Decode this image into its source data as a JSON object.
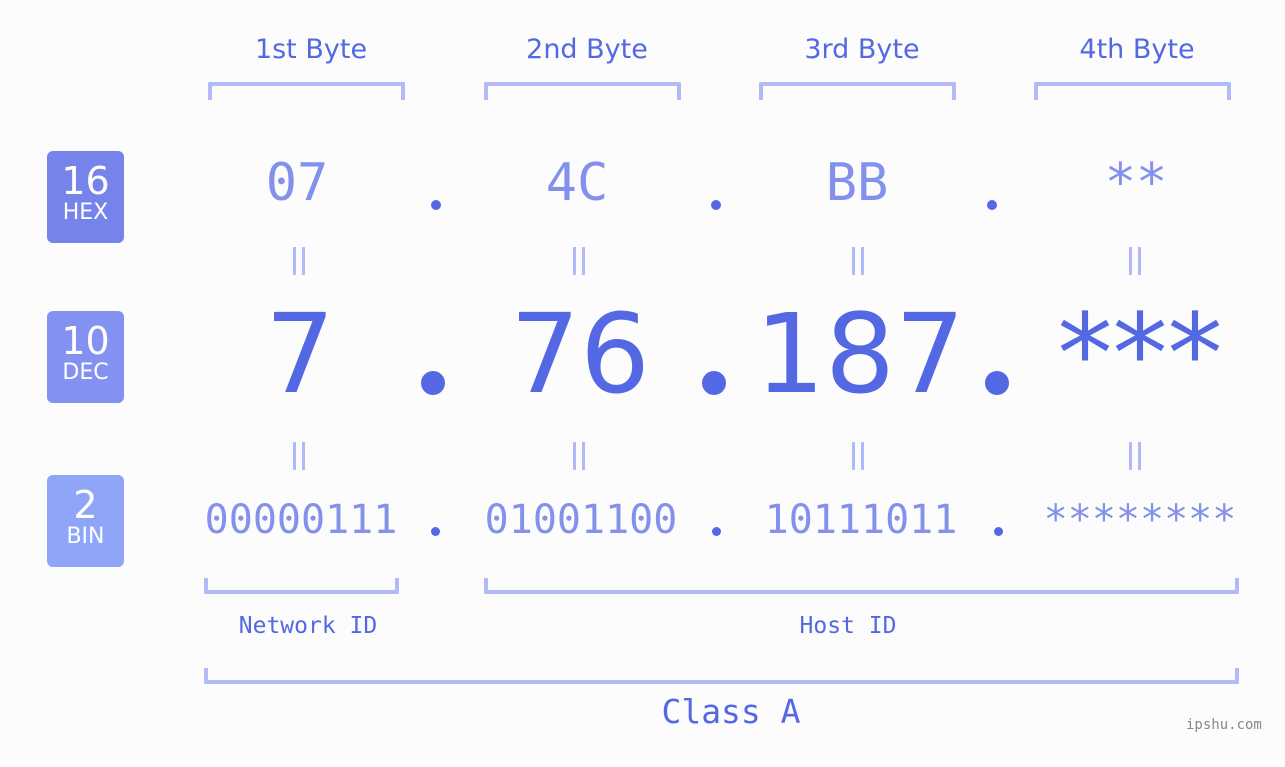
{
  "bytes": [
    {
      "label": "1st Byte",
      "hex": "07",
      "dec": "7",
      "bin": "00000111"
    },
    {
      "label": "2nd Byte",
      "hex": "4C",
      "dec": "76",
      "bin": "01001100"
    },
    {
      "label": "3rd Byte",
      "hex": "BB",
      "dec": "187",
      "bin": "10111011"
    },
    {
      "label": "4th Byte",
      "hex": "**",
      "dec": "***",
      "bin": "********"
    }
  ],
  "badges": [
    {
      "num": "16",
      "sub": "HEX",
      "color": "#7583eb"
    },
    {
      "num": "10",
      "sub": "DEC",
      "color": "#8392f0"
    },
    {
      "num": "2",
      "sub": "BIN",
      "color": "#8fa6f8"
    }
  ],
  "segments": {
    "network": "Network ID",
    "host": "Host ID"
  },
  "ip_class": "Class A",
  "watermark": "ipshu.com",
  "colors": {
    "accent": "#5468e4",
    "light": "#8390ec",
    "bracket": "#b1baf6"
  }
}
